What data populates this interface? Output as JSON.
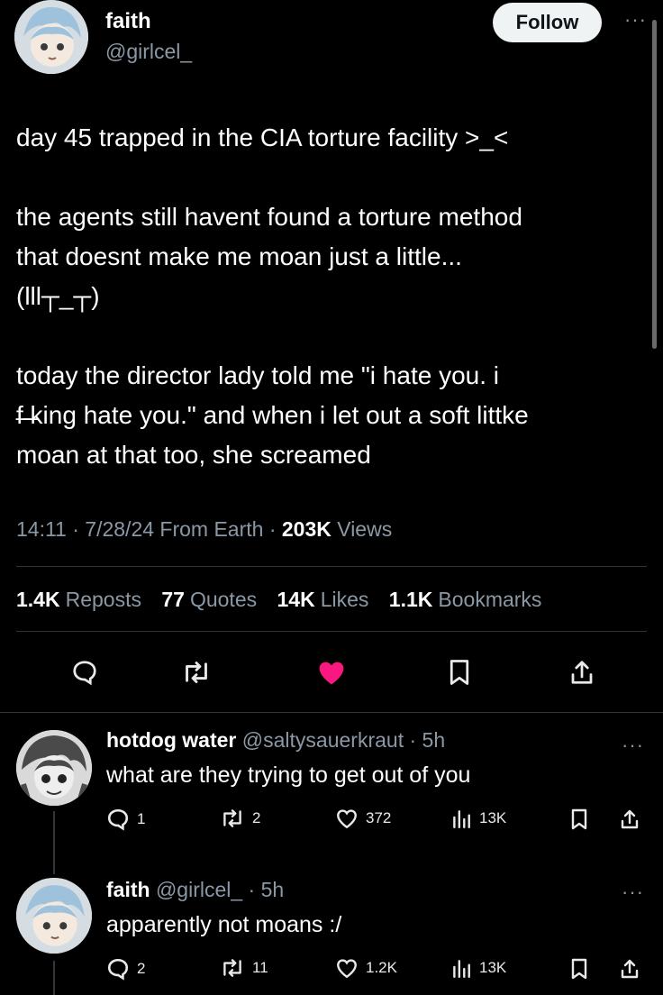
{
  "post": {
    "author_name": "faith",
    "author_handle": "@girlcel_",
    "follow_label": "Follow",
    "lines": [
      "day 45 trapped in the CIA torture facility >_<",
      "",
      "the agents still havent found a torture method",
      "that doesnt make me moan just a little...",
      "(lll┬_┬)",
      "",
      "today the director lady told me \"i hate you. i",
      "f̶ ̶king hate you.\" and when i let out a soft littke",
      "moan at that too, she screamed"
    ],
    "meta_time": "14:11 · 7/28/24 From Earth · ",
    "meta_views_count": "203K",
    "meta_views_label": " Views",
    "stats": {
      "reposts_count": "1.4K",
      "reposts_label": "Reposts",
      "quotes_count": "77",
      "quotes_label": "Quotes",
      "likes_count": "14K",
      "likes_label": "Likes",
      "bookmarks_count": "1.1K",
      "bookmarks_label": "Bookmarks"
    },
    "like_color": "#f91880"
  },
  "replies": [
    {
      "name": "hotdog water",
      "handle_time": "@saltysauerkraut · 5h",
      "text": "what are they trying to get out of you",
      "replies": "1",
      "reposts": "2",
      "likes": "372",
      "views": "13K"
    },
    {
      "name": "faith",
      "handle_time": "@girlcel_ · 5h",
      "text": "apparently not moans :/",
      "replies": "2",
      "reposts": "11",
      "likes": "1.2K",
      "views": "13K"
    }
  ]
}
